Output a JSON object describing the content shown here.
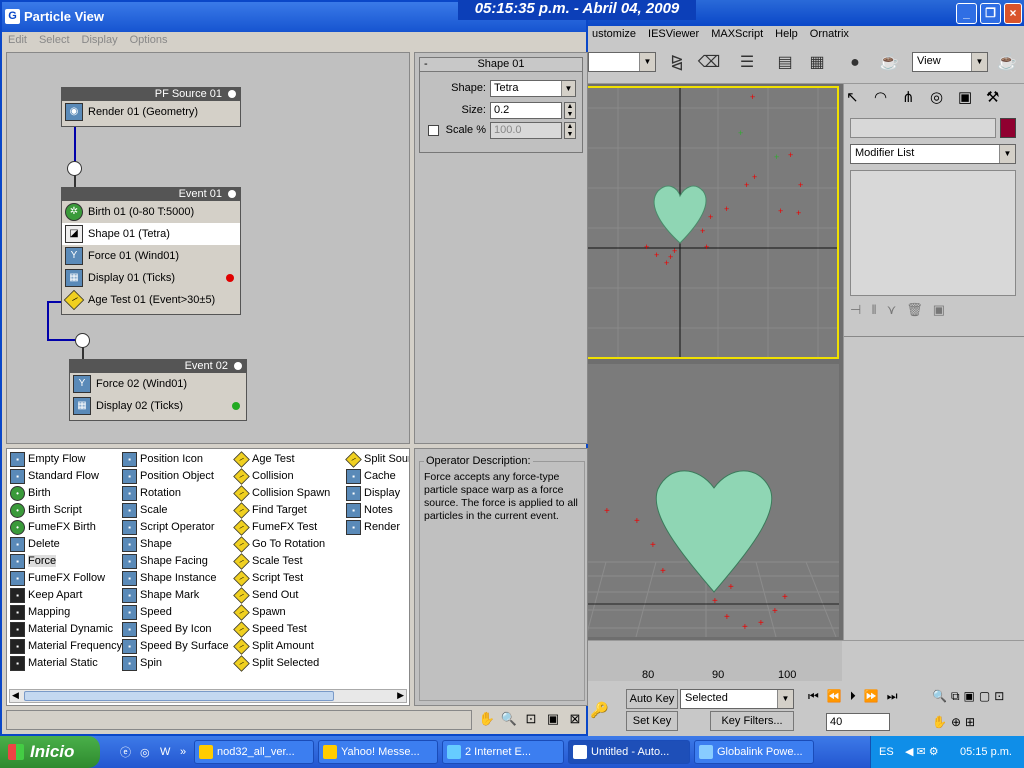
{
  "clock": "05:15:35 p.m. - Abril 04, 2009",
  "pv": {
    "title": "Particle View",
    "menu": [
      "Edit",
      "Select",
      "Display",
      "Options"
    ]
  },
  "graph": {
    "pfsource": {
      "title": "PF Source 01",
      "ops": [
        "Render 01 (Geometry)"
      ]
    },
    "event1": {
      "title": "Event 01",
      "ops": [
        "Birth 01 (0-80 T:5000)",
        "Shape 01 (Tetra)",
        "Force 01 (Wind01)",
        "Display 01 (Ticks)",
        "Age Test 01 (Event>30±5)"
      ]
    },
    "event2": {
      "title": "Event 02",
      "ops": [
        "Force 02 (Wind01)",
        "Display 02 (Ticks)"
      ]
    },
    "dot_colors": {
      "red": "#e00000",
      "green": "#22aa22"
    }
  },
  "params": {
    "rollout": "Shape 01",
    "collapse": "-",
    "shape_label": "Shape:",
    "shape_value": "Tetra",
    "size_label": "Size:",
    "size_value": "0.2",
    "scale_label": "Scale %",
    "scale_value": "100.0"
  },
  "depot": {
    "col1": [
      "Empty Flow",
      "Standard Flow",
      "Birth",
      "Birth Script",
      "FumeFX Birth",
      "Delete",
      "Force",
      "FumeFX Follow",
      "Keep Apart",
      "Mapping",
      "Material Dynamic",
      "Material Frequency",
      "Material Static"
    ],
    "col2": [
      "Position Icon",
      "Position Object",
      "Rotation",
      "Scale",
      "Script Operator",
      "Shape",
      "Shape Facing",
      "Shape Instance",
      "Shape Mark",
      "Speed",
      "Speed By Icon",
      "Speed By Surface",
      "Spin"
    ],
    "col3": [
      "Age Test",
      "Collision",
      "Collision Spawn",
      "Find Target",
      "FumeFX Test",
      "Go To Rotation",
      "Scale Test",
      "Script Test",
      "Send Out",
      "Spawn",
      "Speed Test",
      "Split Amount",
      "Split Selected"
    ],
    "col4": [
      "Split Sour",
      "Cache",
      "Display",
      "Notes",
      "Render"
    ]
  },
  "desc": {
    "legend": "Operator Description:",
    "text": "Force accepts any force-type particle space warp as a force source. The force is applied to all particles in the current event."
  },
  "max": {
    "menu": [
      "ustomize",
      "IESViewer",
      "MAXScript",
      "Help",
      "Ornatrix"
    ],
    "view_select": "View",
    "modifier_list": "Modifier List",
    "autokey": "Auto Key",
    "setkey": "Set Key",
    "selected": "Selected",
    "keyfilters": "Key Filters...",
    "frame": "40",
    "ticks": [
      "80",
      "90",
      "100"
    ]
  },
  "taskbar": {
    "start": "Inicio",
    "tasks": [
      "nod32_all_ver...",
      "Yahoo! Messe...",
      "2 Internet E...",
      "Untitled - Auto...",
      "Globalink Powe..."
    ],
    "lang": "ES",
    "time": "05:15 p.m."
  }
}
